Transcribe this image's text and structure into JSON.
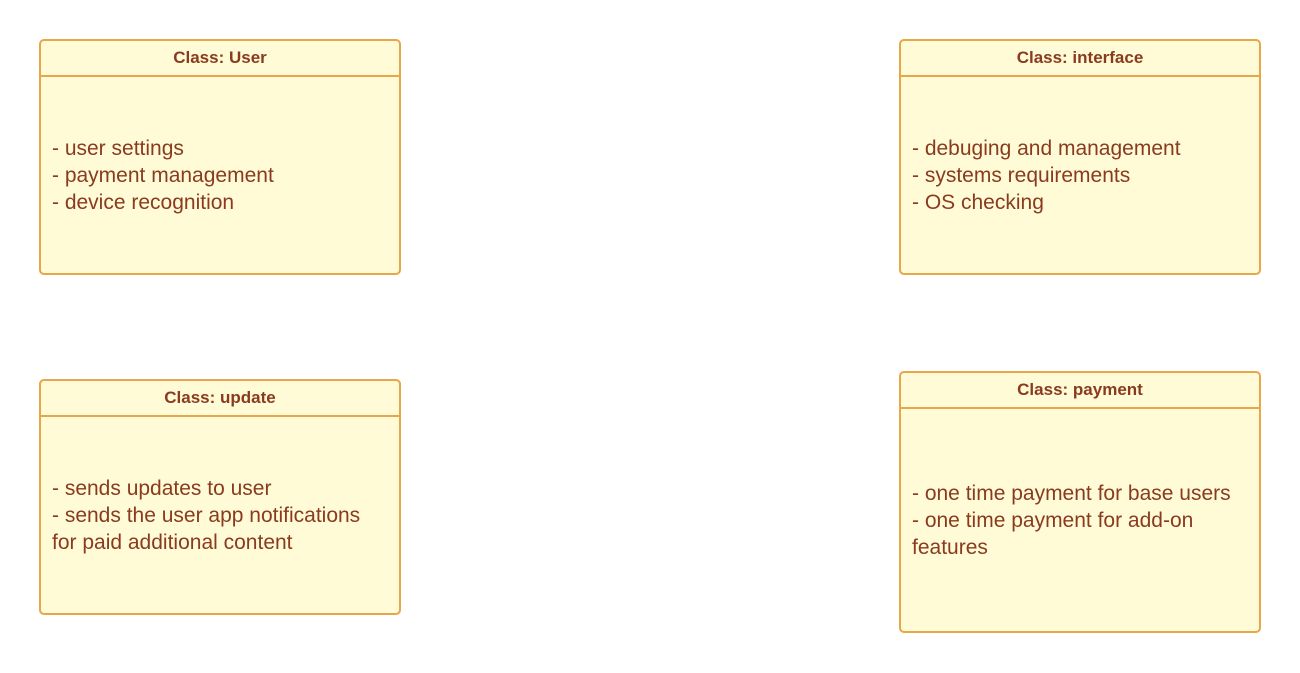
{
  "diagram": {
    "classes": [
      {
        "title": "Class: User",
        "body": "- user settings\n- payment management\n- device recognition"
      },
      {
        "title": "Class: interface",
        "body": "- debuging and management\n- systems requirements\n- OS checking"
      },
      {
        "title": "Class: update",
        "body": "- sends updates to user\n- sends the user app notifications for paid additional content"
      },
      {
        "title": "Class: payment",
        "body": "- one time payment for base users\n- one time payment for add-on features"
      }
    ],
    "colors": {
      "fill": "#fffbd6",
      "border": "#e8a64a",
      "text": "#8a3b1f",
      "background": "#ffffff"
    }
  }
}
